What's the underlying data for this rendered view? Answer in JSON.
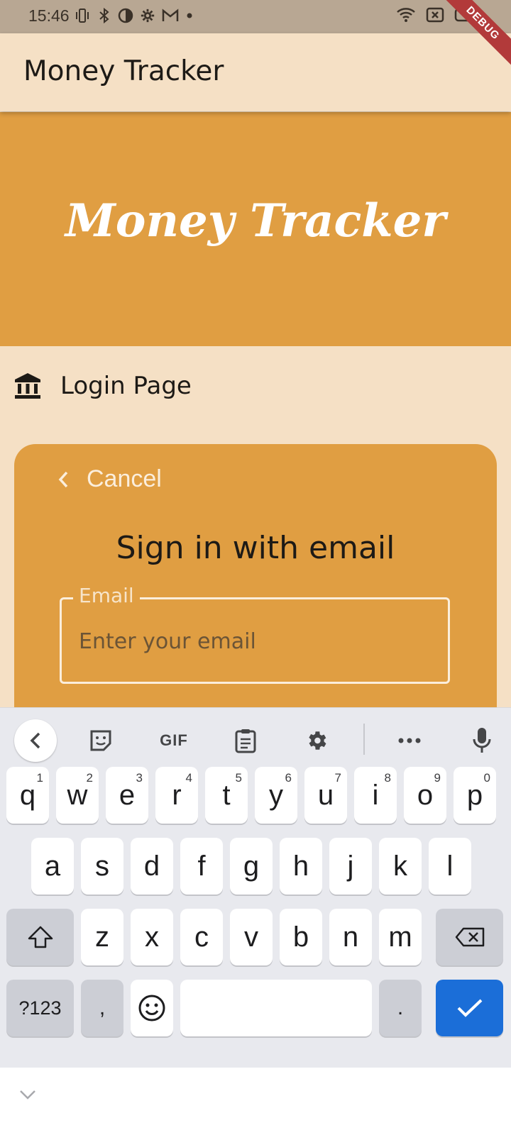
{
  "status_bar": {
    "time": "15:46"
  },
  "debug_ribbon": "DEBUG",
  "app_bar": {
    "title": "Money Tracker"
  },
  "banner": {
    "title": "Money Tracker"
  },
  "section": {
    "label": "Login Page",
    "icon": "bank-icon"
  },
  "card": {
    "cancel_label": "Cancel",
    "heading": "Sign in with email",
    "email_field": {
      "label": "Email",
      "placeholder": "Enter your email",
      "value": ""
    }
  },
  "keyboard": {
    "toolbar": {
      "gif_label": "GIF"
    },
    "row1": [
      {
        "label": "q",
        "hint": "1"
      },
      {
        "label": "w",
        "hint": "2"
      },
      {
        "label": "e",
        "hint": "3"
      },
      {
        "label": "r",
        "hint": "4"
      },
      {
        "label": "t",
        "hint": "5"
      },
      {
        "label": "y",
        "hint": "6"
      },
      {
        "label": "u",
        "hint": "7"
      },
      {
        "label": "i",
        "hint": "8"
      },
      {
        "label": "o",
        "hint": "9"
      },
      {
        "label": "p",
        "hint": "0"
      }
    ],
    "row2": [
      "a",
      "s",
      "d",
      "f",
      "g",
      "h",
      "j",
      "k",
      "l"
    ],
    "row3": [
      "z",
      "x",
      "c",
      "v",
      "b",
      "n",
      "m"
    ],
    "symbols_label": "?123",
    "comma_label": ",",
    "period_label": "."
  },
  "colors": {
    "accent": "#e09e42",
    "background": "#f5e0c5",
    "enter_key": "#1b6ed8"
  }
}
